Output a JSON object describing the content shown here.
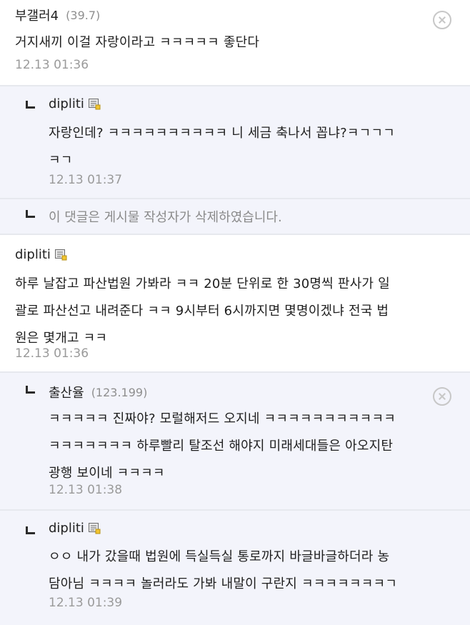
{
  "comments": [
    {
      "author": "부갤러4",
      "ip": "(39.7)",
      "text": "거지새끼 이걸 자랑이라고 ㅋㅋㅋㅋㅋ 좋단다",
      "time": "12.13 01:36"
    },
    {
      "author": "dipliti",
      "line1": "자랑인데? ㅋㅋㅋㅋㅋㅋㅋㅋㅋㅋ 니 세금 축나서 꼽냐?ㅋㄱㄱㄱ",
      "line2": "ㅋㄱ",
      "time": "12.13 01:37"
    },
    {
      "deleted_text": "이 댓글은 게시물 작성자가 삭제하였습니다."
    },
    {
      "author": "dipliti",
      "line1": "하루 날잡고 파산법원 가봐라 ㅋㅋ 20분 단위로 한 30명씩 판사가 일",
      "line2": "괄로 파산선고 내려준다 ㅋㅋ 9시부터 6시까지면 몇명이겠냐 전국 법",
      "line3": "원은 몇개고 ㅋㅋ",
      "time": "12.13 01:36"
    },
    {
      "author": "출산율",
      "ip": "(123.199)",
      "line1": "ㅋㅋㅋㅋㅋ 진짜야? 모럴해저드 오지네 ㅋㅋㅋㅋㅋㅋㅋㅋㅋㅋㅋ",
      "line2": "ㅋㅋㅋㅋㅋㅋㅋ 하루빨리 탈조선 해야지 미래세대들은 아오지탄",
      "line3": "광행 보이네 ㅋㅋㅋㅋ",
      "time": "12.13 01:38"
    },
    {
      "author": "dipliti",
      "line1": "ㅇㅇ 내가 갔을때 법원에 득실득실 통로까지 바글바글하더라 농",
      "line2": "담아님 ㅋㅋㅋㅋ 놀러라도 가봐 내말이 구란지 ㅋㅋㅋㅋㅋㅋㅋㄱ",
      "time": "12.13 01:39"
    }
  ],
  "icons": {
    "reply": "reply-arrow-icon",
    "delete": "close-circle-icon",
    "memo": "fixed-nick-memo-icon"
  },
  "colors": {
    "reply_bg": "#f3f4fb",
    "divider": "#e6e8ee",
    "time": "#9a9a9a"
  }
}
